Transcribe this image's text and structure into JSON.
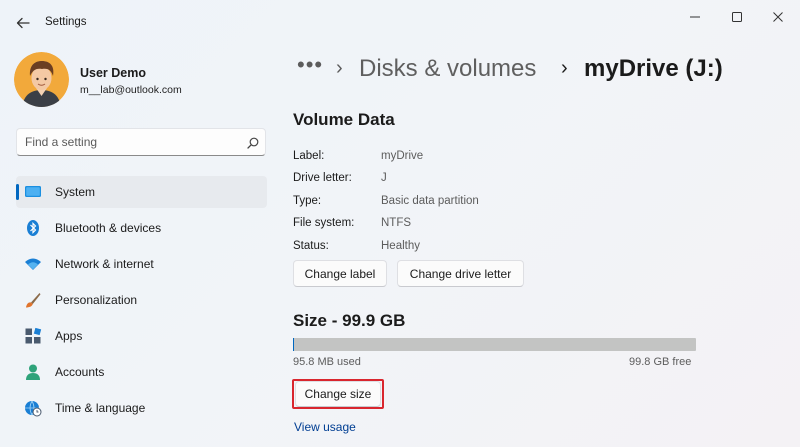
{
  "window": {
    "app_title": "Settings",
    "controls": [
      "minimize-icon",
      "maximize-icon",
      "close-icon"
    ]
  },
  "profile": {
    "name": "User Demo",
    "email": "m__lab@outlook.com"
  },
  "search": {
    "placeholder": "Find a setting",
    "value": ""
  },
  "sidebar": {
    "items": [
      {
        "label": "System",
        "icon": "system-monitor-icon",
        "selected": true
      },
      {
        "label": "Bluetooth & devices",
        "icon": "bluetooth-icon"
      },
      {
        "label": "Network & internet",
        "icon": "wifi-icon"
      },
      {
        "label": "Personalization",
        "icon": "paintbrush-icon"
      },
      {
        "label": "Apps",
        "icon": "apps-icon"
      },
      {
        "label": "Accounts",
        "icon": "account-icon"
      },
      {
        "label": "Time & language",
        "icon": "globe-clock-icon"
      }
    ]
  },
  "breadcrumb": {
    "ellipsis": "•••",
    "separator": "›",
    "parent": "Disks & volumes",
    "current": "myDrive (J:)"
  },
  "volume": {
    "title": "Volume Data",
    "properties": [
      {
        "label": "Label:",
        "value": "myDrive"
      },
      {
        "label": "Drive letter:",
        "value": "J"
      },
      {
        "label": "Type:",
        "value": "Basic data partition"
      },
      {
        "label": "File system:",
        "value": "NTFS"
      },
      {
        "label": "Status:",
        "value": "Healthy"
      }
    ],
    "change_label_button": "Change label",
    "change_letter_button": "Change drive letter"
  },
  "size": {
    "title": "Size - 99.9 GB",
    "used_text": "95.8 MB used",
    "free_text": "99.8 GB free",
    "used_fraction": 0.001,
    "change_size_button": "Change size",
    "view_usage_link": "View usage"
  },
  "colors": {
    "accent": "#0067c0",
    "highlight_box": "#d9262e",
    "link": "#003e92"
  }
}
